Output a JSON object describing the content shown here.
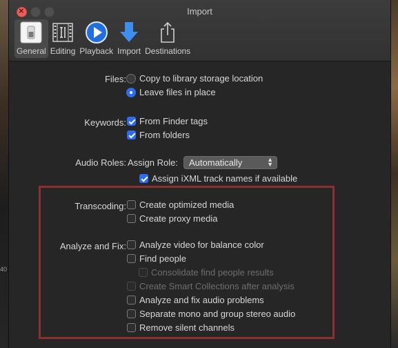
{
  "window": {
    "title": "Import"
  },
  "background": {
    "timecode": "40"
  },
  "toolbar": {
    "items": [
      {
        "label": "General",
        "icon": "general-switch-icon",
        "selected": true
      },
      {
        "label": "Editing",
        "icon": "film-strip-icon",
        "selected": false
      },
      {
        "label": "Playback",
        "icon": "play-icon",
        "selected": false
      },
      {
        "label": "Import",
        "icon": "import-arrow-icon",
        "selected": false
      },
      {
        "label": "Destinations",
        "icon": "share-icon",
        "selected": false
      }
    ]
  },
  "files": {
    "label": "Files:",
    "options": [
      {
        "label": "Copy to library storage location",
        "selected": false
      },
      {
        "label": "Leave files in place",
        "selected": true
      }
    ]
  },
  "keywords": {
    "label": "Keywords:",
    "options": [
      {
        "label": "From Finder tags",
        "checked": true
      },
      {
        "label": "From folders",
        "checked": true
      }
    ]
  },
  "audio_roles": {
    "label": "Audio Roles:",
    "assign_label": "Assign Role:",
    "assign_value": "Automatically",
    "ixml": {
      "label": "Assign iXML track names if available",
      "checked": true
    }
  },
  "transcoding": {
    "label": "Transcoding:",
    "options": [
      {
        "label": "Create optimized media",
        "checked": false
      },
      {
        "label": "Create proxy media",
        "checked": false
      }
    ]
  },
  "analyze": {
    "label": "Analyze and Fix:",
    "options": [
      {
        "label": "Analyze video for balance color",
        "checked": false,
        "enabled": true
      },
      {
        "label": "Find people",
        "checked": false,
        "enabled": true
      },
      {
        "label": "Consolidate find people results",
        "checked": false,
        "enabled": false
      },
      {
        "label": "Create Smart Collections after analysis",
        "checked": false,
        "enabled": false
      },
      {
        "label": "Analyze and fix audio problems",
        "checked": false,
        "enabled": true
      },
      {
        "label": "Separate mono and group stereo audio",
        "checked": false,
        "enabled": true
      },
      {
        "label": "Remove silent channels",
        "checked": false,
        "enabled": true
      }
    ]
  },
  "colors": {
    "accent": "#2d6df6",
    "highlight_border": "#8c3030",
    "window_bg": "#262626"
  }
}
